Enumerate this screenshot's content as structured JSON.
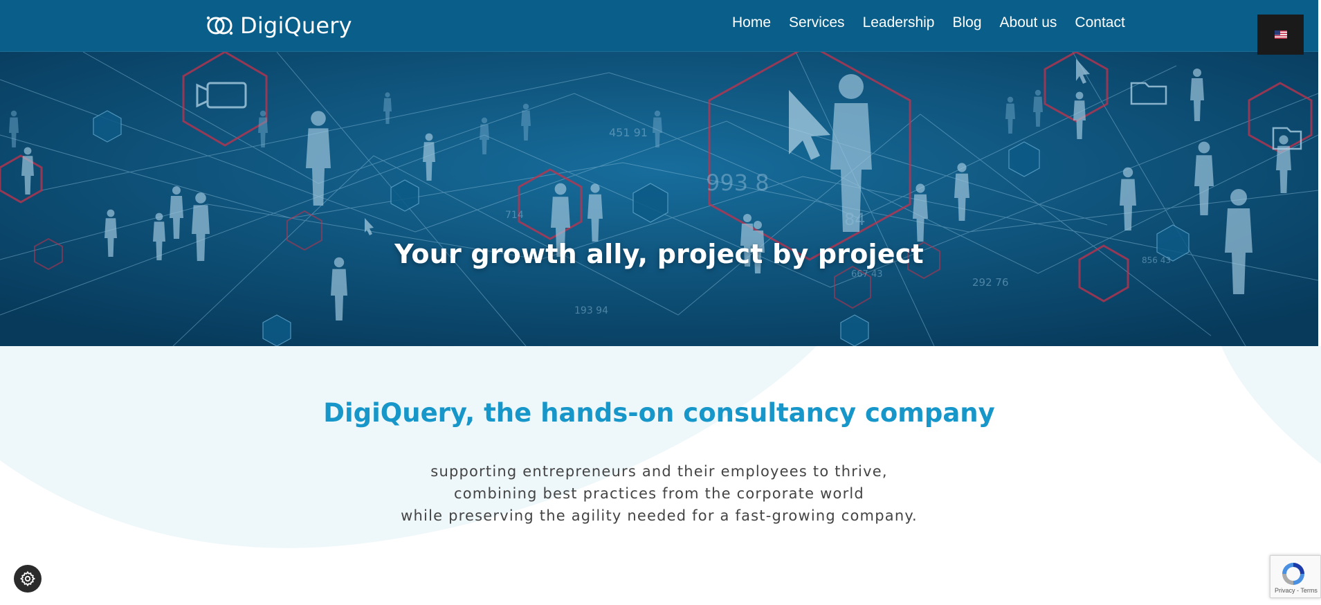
{
  "brand": {
    "name": "DigiQuery"
  },
  "nav": {
    "items": [
      {
        "label": "Home"
      },
      {
        "label": "Services"
      },
      {
        "label": "Leadership"
      },
      {
        "label": "Blog"
      },
      {
        "label": "About us"
      },
      {
        "label": "Contact"
      }
    ]
  },
  "language": {
    "flag_icon": "us-flag-icon",
    "selected": "English"
  },
  "hero": {
    "title": "Your growth ally, project by project",
    "bg_numbers": [
      "451 91",
      "993 8",
      "84",
      "714",
      "193 94",
      "292 76",
      "667 43",
      "856 43"
    ]
  },
  "intro": {
    "title": "DigiQuery, the hands-on consultancy company",
    "lines": [
      "supporting entrepreneurs and their employees to thrive,",
      "combining best practices from the corporate world",
      "while preserving the agility needed for a fast-growing company."
    ]
  },
  "cookie": {
    "icon": "gear-icon"
  },
  "recaptcha": {
    "privacy": "Privacy",
    "terms": "Terms",
    "separator": " - "
  },
  "colors": {
    "header": "#0a5f8a",
    "hero_bg": "#0a4f78",
    "accent": "#1696c9",
    "hex_red": "#c4314b",
    "curve_bg": "#eef7f9"
  }
}
